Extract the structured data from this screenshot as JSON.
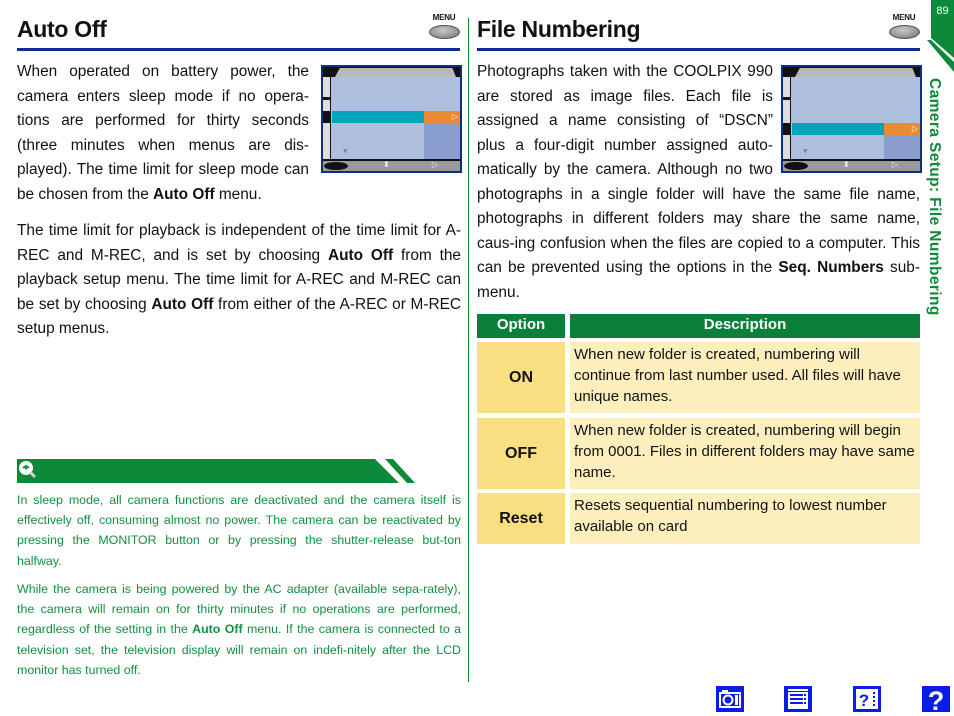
{
  "page": {
    "number": "89",
    "side_title": "Camera Setup: File Numbering"
  },
  "left": {
    "title": "Auto Off",
    "menu_label": "MENU",
    "para1": [
      {
        "t": "When operated on battery power, the camera enters sleep mode if no opera-tions are performed for thirty seconds (three minutes when menus are dis-played).  The time limit for sleep mode can be chosen from the "
      },
      {
        "b": "Auto Off"
      },
      {
        "t": " menu."
      }
    ],
    "para2": [
      {
        "t": "The time limit for playback is independent of the time limit for A-REC and M-REC, and is set by choosing "
      },
      {
        "b": "Auto Off"
      },
      {
        "t": " from the playback setup menu.  The time limit for A-REC and M-REC can be set by choosing "
      },
      {
        "b": "Auto Off"
      },
      {
        "t": " from either of the A-REC or M-REC setup menus."
      }
    ],
    "tip": {
      "icon": "lightbulb-tip-icon",
      "para1": "In sleep mode, all camera functions are deactivated and the camera itself is effectively off, consuming almost no power. The camera can be reactivated by pressing the MONITOR button or by pressing the shutter-release but-ton halfway.",
      "para2": [
        {
          "t": "While the camera is being powered by the AC adapter (available sepa-rately), the camera will remain on for thirty minutes if no operations are performed, regardless of the setting in the "
        },
        {
          "b": "Auto Off"
        },
        {
          "t": " menu.  If the camera is connected to a television set, the television display will remain on indefi-nitely after the LCD monitor has turned off."
        }
      ]
    }
  },
  "right": {
    "title": "File Numbering",
    "menu_label": "MENU",
    "para1": [
      {
        "t": "Photographs taken with the COOLPIX 990 are stored as image files.  Each file is assigned a name consisting of “DSCN” plus a four-digit number assigned auto-matically by the camera. Although no two photographs in a single folder will have the same file name, photographs in different folders may share the same name, caus-ing confusion when the files are copied to a computer.   This can be prevented using the options in the "
      },
      {
        "b": "Seq. Numbers"
      },
      {
        "t": " sub-menu."
      }
    ],
    "table": {
      "headers": [
        "Option",
        "Description"
      ],
      "rows": [
        {
          "option": "ON",
          "description": "When new folder is created, numbering will continue from last number used.  All files will have unique names."
        },
        {
          "option": "OFF",
          "description": "When new folder is created, numbering will begin from 0001.  Files in different folders may have same name."
        },
        {
          "option": "Reset",
          "description": "Resets sequential numbering to lowest number available on card"
        }
      ]
    }
  },
  "nav": [
    {
      "name": "camera-icon"
    },
    {
      "name": "contents-icon"
    },
    {
      "name": "index-help-icon"
    },
    {
      "name": "help-icon"
    }
  ],
  "colors": {
    "accent_green": "#0c8a3a",
    "title_rule_blue": "#0d2f8c",
    "table_option_bg": "#f9df82",
    "table_desc_bg": "#fdefbd",
    "nav_blue": "#0a1de8"
  }
}
